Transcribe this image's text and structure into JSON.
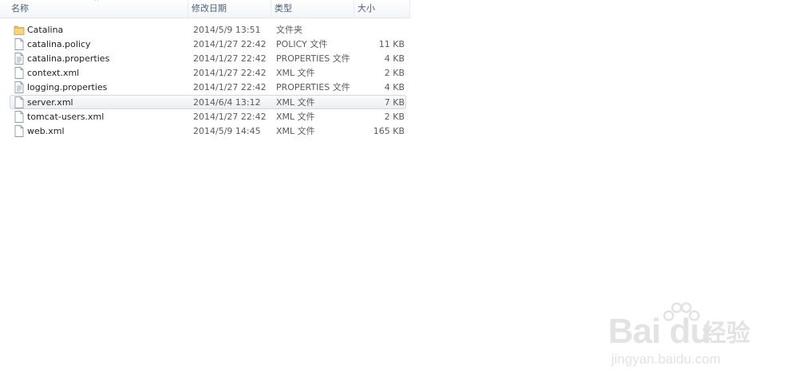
{
  "columns": {
    "name": "名称",
    "date": "修改日期",
    "type": "类型",
    "size": "大小"
  },
  "files": [
    {
      "name": "Catalina",
      "date": "2014/5/9 13:51",
      "type": "文件夹",
      "size": "",
      "icon": "folder-icon"
    },
    {
      "name": "catalina.policy",
      "date": "2014/1/27 22:42",
      "type": "POLICY 文件",
      "size": "11 KB",
      "icon": "file-icon"
    },
    {
      "name": "catalina.properties",
      "date": "2014/1/27 22:42",
      "type": "PROPERTIES 文件",
      "size": "4 KB",
      "icon": "text-file-icon"
    },
    {
      "name": "context.xml",
      "date": "2014/1/27 22:42",
      "type": "XML 文件",
      "size": "2 KB",
      "icon": "file-icon"
    },
    {
      "name": "logging.properties",
      "date": "2014/1/27 22:42",
      "type": "PROPERTIES 文件",
      "size": "4 KB",
      "icon": "text-file-icon"
    },
    {
      "name": "server.xml",
      "date": "2014/6/4 13:12",
      "type": "XML 文件",
      "size": "7 KB",
      "icon": "file-icon",
      "hovered": true
    },
    {
      "name": "tomcat-users.xml",
      "date": "2014/1/27 22:42",
      "type": "XML 文件",
      "size": "2 KB",
      "icon": "file-icon"
    },
    {
      "name": "web.xml",
      "date": "2014/5/9 14:45",
      "type": "XML 文件",
      "size": "165 KB",
      "icon": "file-icon"
    }
  ],
  "watermark": {
    "logo": "Bai du",
    "jingyan": "经验",
    "url": "jingyan.baidu.com"
  },
  "colors": {
    "header_text": "#4c607a",
    "hover_border": "#d5d8dd",
    "folder": "#e8c25a",
    "watermark": "#e3e3e3"
  }
}
